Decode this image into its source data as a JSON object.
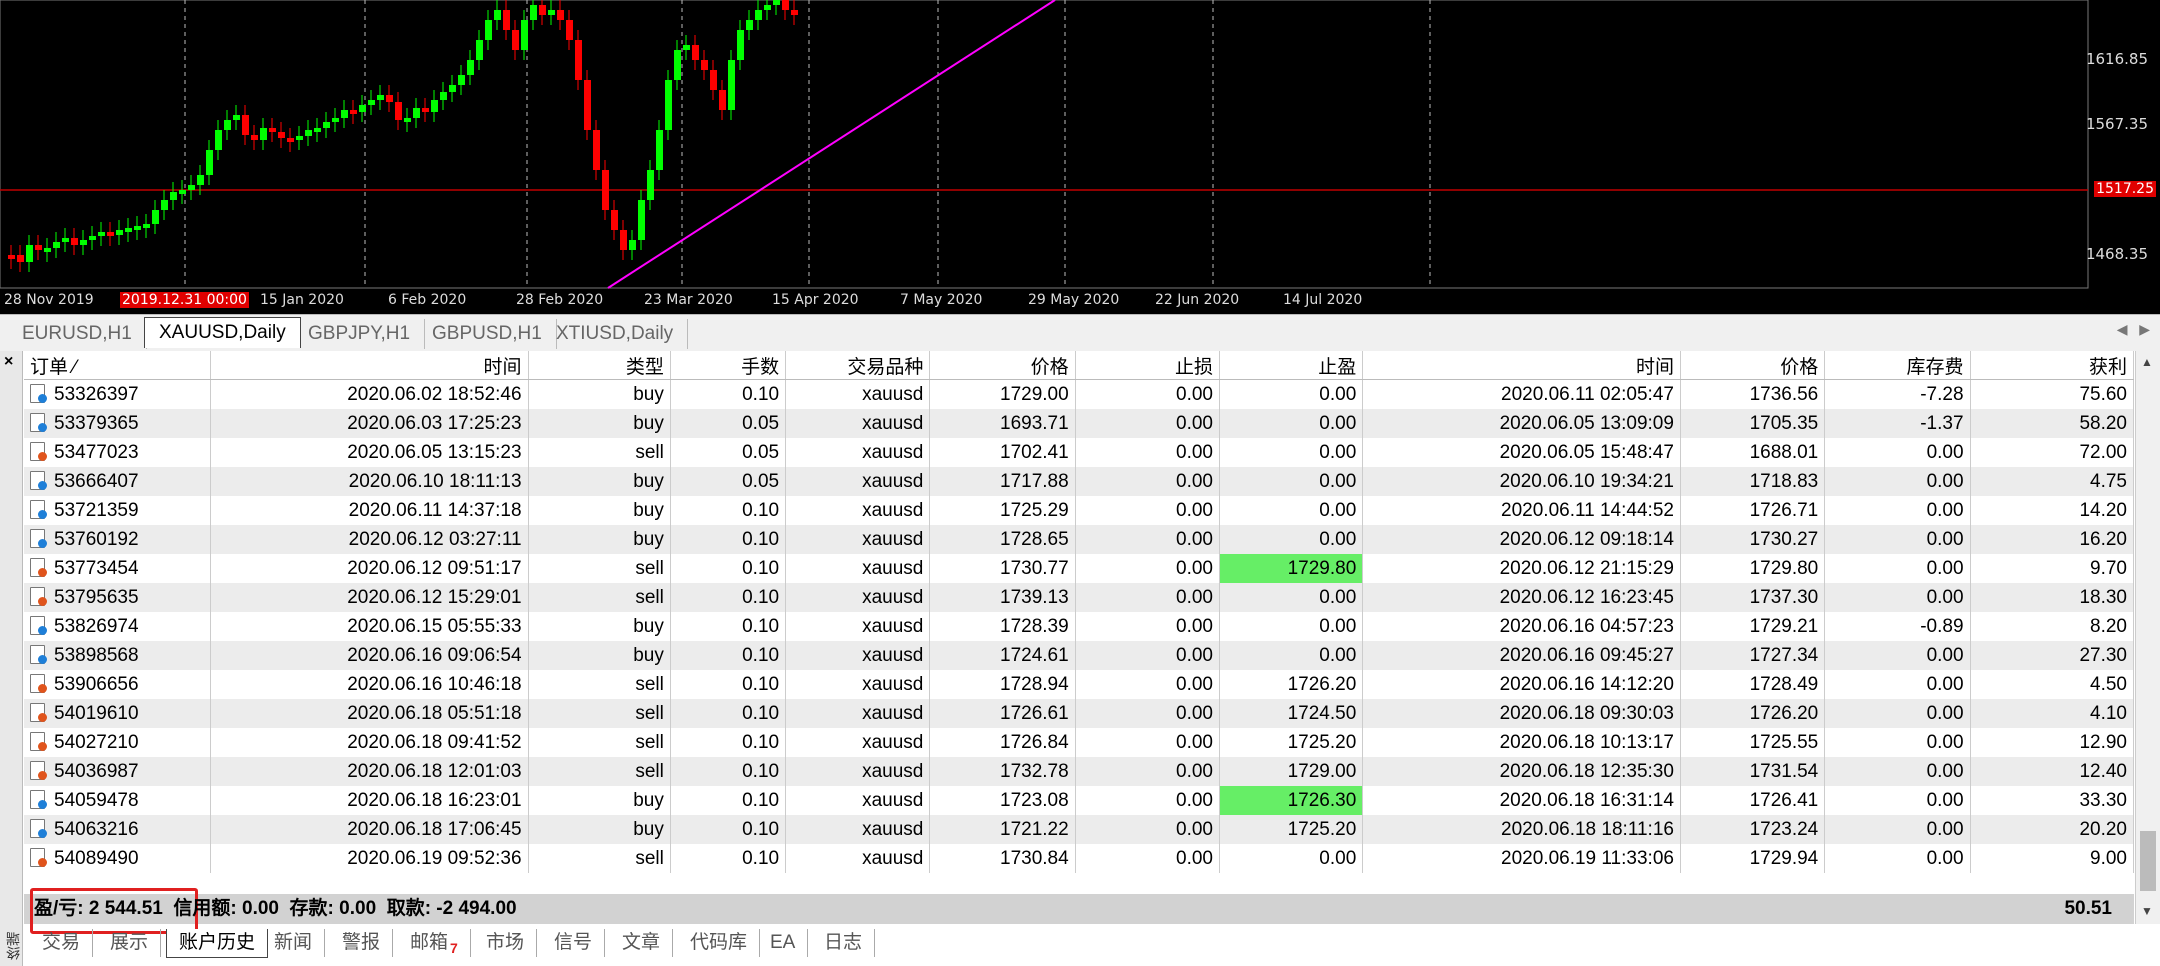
{
  "chart": {
    "price_labels": [
      "1616.85",
      "1567.35",
      "1468.35"
    ],
    "current_price": "1517.25",
    "date_labels": [
      "28 Nov 2019",
      "2019.12.31 00:00",
      "15 Jan 2020",
      "6 Feb 2020",
      "28 Feb 2020",
      "23 Mar 2020",
      "15 Apr 2020",
      "7 May 2020",
      "29 May 2020",
      "22 Jun 2020",
      "14 Jul 2020"
    ],
    "colors": {
      "bull": "#00ff00",
      "bear": "#ff0000",
      "trendline": "#ff00ff",
      "hline": "#c00000"
    }
  },
  "chart_tabs": [
    "EURUSD,H1",
    "XAUUSD,Daily",
    "GBPJPY,H1",
    "GBPUSD,H1",
    "XTIUSD,Daily"
  ],
  "active_chart_tab": "XAUUSD,Daily",
  "terminal": {
    "close_label": "×",
    "side_title": "终端",
    "columns": [
      "订单",
      "时间",
      "类型",
      "手数",
      "交易品种",
      "价格",
      "止损",
      "止盈",
      "时间",
      "价格",
      "库存费",
      "获利"
    ],
    "sort_indicator": "⁄",
    "rows": [
      [
        "53326397",
        "2020.06.02 18:52:46",
        "buy",
        "0.10",
        "xauusd",
        "1729.00",
        "0.00",
        "0.00",
        "2020.06.11 02:05:47",
        "1736.56",
        "-7.28",
        "75.60"
      ],
      [
        "53379365",
        "2020.06.03 17:25:23",
        "buy",
        "0.05",
        "xauusd",
        "1693.71",
        "0.00",
        "0.00",
        "2020.06.05 13:09:09",
        "1705.35",
        "-1.37",
        "58.20"
      ],
      [
        "53477023",
        "2020.06.05 13:15:23",
        "sell",
        "0.05",
        "xauusd",
        "1702.41",
        "0.00",
        "0.00",
        "2020.06.05 15:48:47",
        "1688.01",
        "0.00",
        "72.00"
      ],
      [
        "53666407",
        "2020.06.10 18:11:13",
        "buy",
        "0.05",
        "xauusd",
        "1717.88",
        "0.00",
        "0.00",
        "2020.06.10 19:34:21",
        "1718.83",
        "0.00",
        "4.75"
      ],
      [
        "53721359",
        "2020.06.11 14:37:18",
        "buy",
        "0.10",
        "xauusd",
        "1725.29",
        "0.00",
        "0.00",
        "2020.06.11 14:44:52",
        "1726.71",
        "0.00",
        "14.20"
      ],
      [
        "53760192",
        "2020.06.12 03:27:11",
        "buy",
        "0.10",
        "xauusd",
        "1728.65",
        "0.00",
        "0.00",
        "2020.06.12 09:18:14",
        "1730.27",
        "0.00",
        "16.20"
      ],
      [
        "53773454",
        "2020.06.12 09:51:17",
        "sell",
        "0.10",
        "xauusd",
        "1730.77",
        "0.00",
        "1729.80",
        "2020.06.12 21:15:29",
        "1729.80",
        "0.00",
        "9.70"
      ],
      [
        "53795635",
        "2020.06.12 15:29:01",
        "sell",
        "0.10",
        "xauusd",
        "1739.13",
        "0.00",
        "0.00",
        "2020.06.12 16:23:45",
        "1737.30",
        "0.00",
        "18.30"
      ],
      [
        "53826974",
        "2020.06.15 05:55:33",
        "buy",
        "0.10",
        "xauusd",
        "1728.39",
        "0.00",
        "0.00",
        "2020.06.16 04:57:23",
        "1729.21",
        "-0.89",
        "8.20"
      ],
      [
        "53898568",
        "2020.06.16 09:06:54",
        "buy",
        "0.10",
        "xauusd",
        "1724.61",
        "0.00",
        "0.00",
        "2020.06.16 09:45:27",
        "1727.34",
        "0.00",
        "27.30"
      ],
      [
        "53906656",
        "2020.06.16 10:46:18",
        "sell",
        "0.10",
        "xauusd",
        "1728.94",
        "0.00",
        "1726.20",
        "2020.06.16 14:12:20",
        "1728.49",
        "0.00",
        "4.50"
      ],
      [
        "54019610",
        "2020.06.18 05:51:18",
        "sell",
        "0.10",
        "xauusd",
        "1726.61",
        "0.00",
        "1724.50",
        "2020.06.18 09:30:03",
        "1726.20",
        "0.00",
        "4.10"
      ],
      [
        "54027210",
        "2020.06.18 09:41:52",
        "sell",
        "0.10",
        "xauusd",
        "1726.84",
        "0.00",
        "1725.20",
        "2020.06.18 10:13:17",
        "1725.55",
        "0.00",
        "12.90"
      ],
      [
        "54036987",
        "2020.06.18 12:01:03",
        "sell",
        "0.10",
        "xauusd",
        "1732.78",
        "0.00",
        "1729.00",
        "2020.06.18 12:35:30",
        "1731.54",
        "0.00",
        "12.40"
      ],
      [
        "54059478",
        "2020.06.18 16:23:01",
        "buy",
        "0.10",
        "xauusd",
        "1723.08",
        "0.00",
        "1726.30",
        "2020.06.18 16:31:14",
        "1726.41",
        "0.00",
        "33.30"
      ],
      [
        "54063216",
        "2020.06.18 17:06:45",
        "buy",
        "0.10",
        "xauusd",
        "1721.22",
        "0.00",
        "1725.20",
        "2020.06.18 18:11:16",
        "1723.24",
        "0.00",
        "20.20"
      ],
      [
        "54089490",
        "2020.06.19 09:52:36",
        "sell",
        "0.10",
        "xauusd",
        "1730.84",
        "0.00",
        "0.00",
        "2020.06.19 11:33:06",
        "1729.94",
        "0.00",
        "9.00"
      ]
    ],
    "highlight_tp_rows": [
      6,
      14
    ],
    "summary": {
      "text": "盈/亏: 2 544.51  信用额: 0.00  存款: 0.00  取款: -2 494.00",
      "total": "50.51"
    }
  },
  "bottom_tabs": [
    "交易",
    "展示",
    "账户历史",
    "新闻",
    "警报",
    "邮箱",
    "市场",
    "信号",
    "文章",
    "代码库",
    "EA",
    "日志"
  ],
  "active_bottom_tab": "账户历史",
  "mailbox_badge": "7"
}
